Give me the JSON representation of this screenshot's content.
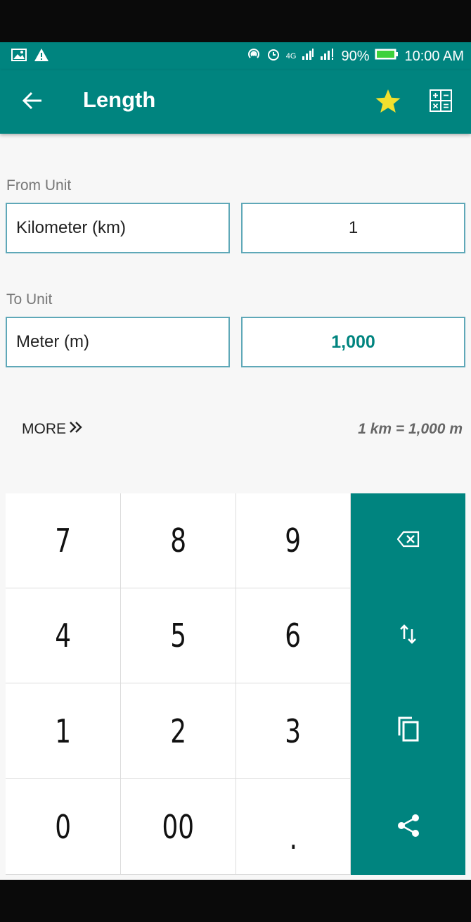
{
  "status_bar": {
    "network_label": "4G",
    "battery": "90%",
    "time": "10:00 AM"
  },
  "app_bar": {
    "title": "Length",
    "icons": [
      "back-arrow-icon",
      "star-icon",
      "calculator-icon"
    ],
    "star_color": "#f2e02e"
  },
  "from": {
    "label": "From Unit",
    "unit": "Kilometer (km)",
    "value": "1"
  },
  "to": {
    "label": "To Unit",
    "unit": "Meter (m)",
    "value": "1,000"
  },
  "more": {
    "label": "MORE"
  },
  "formula": "1 km = 1,000 m",
  "keypad": {
    "keys": [
      "7",
      "8",
      "9",
      "4",
      "5",
      "6",
      "1",
      "2",
      "3",
      "0",
      "00",
      "."
    ],
    "actions": [
      "backspace-icon",
      "swap-icon",
      "copy-icon",
      "share-icon"
    ]
  },
  "colors": {
    "accent": "#00847f",
    "field_border": "#5fa8b8"
  }
}
